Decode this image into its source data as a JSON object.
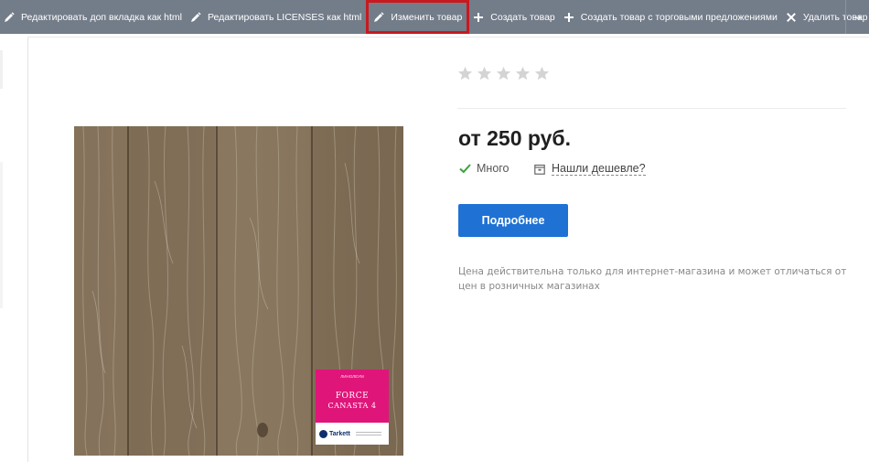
{
  "toolbar": {
    "items": [
      {
        "label": "Редактировать доп вкладка как html",
        "icon": "pencil-icon"
      },
      {
        "label": "Редактировать LICENSES как html",
        "icon": "pencil-icon"
      },
      {
        "label": "Изменить товар",
        "icon": "pencil-icon",
        "highlighted": true
      },
      {
        "label": "Создать товар",
        "icon": "plus-icon"
      },
      {
        "label": "Создать товар с торговыми предложениями",
        "icon": "plus-icon"
      },
      {
        "label": "Удалить товар",
        "icon": "close-icon"
      }
    ],
    "end_icon": "collapse-arrow-icon",
    "background": "#737c89",
    "highlight_color": "#c8191f"
  },
  "product": {
    "image_badge": {
      "top_text": "ЛИНОЛЕУМ",
      "name": "FORCE",
      "variant": "CANASTA 4",
      "brand": "Tarkett",
      "color": "#e0157a"
    },
    "rating": {
      "stars_total": 5,
      "stars_filled": 0
    },
    "price": "от 250 руб.",
    "availability": "Много",
    "cheaper_link": "Нашли дешевле?",
    "details_button": "Подробнее",
    "note": "Цена действительна только для интернет-магазина и может отличаться от цен в розничных магазинах",
    "accent_color": "#1f72d4"
  }
}
